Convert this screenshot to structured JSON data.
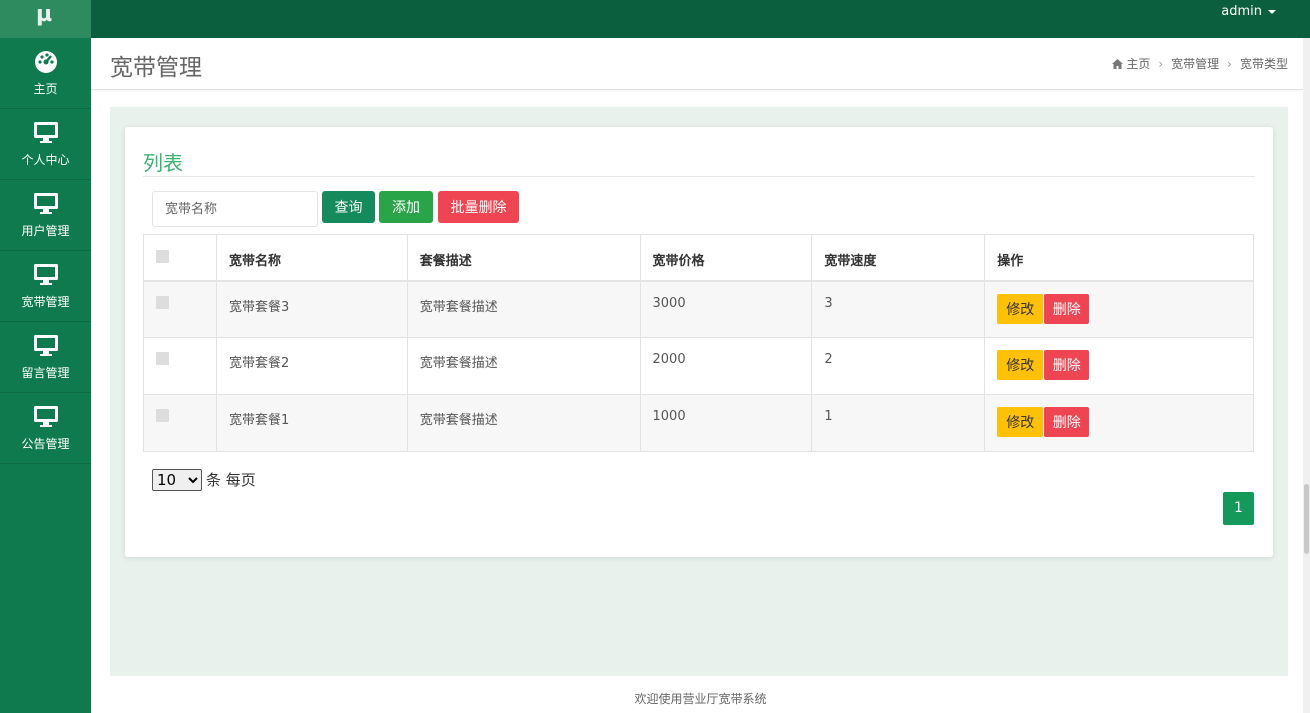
{
  "app": {
    "logo_text": "µ",
    "user_label": "admin"
  },
  "sidebar": {
    "items": [
      {
        "label": "主页",
        "icon": "dashboard-icon"
      },
      {
        "label": "个人中心",
        "icon": "monitor-icon"
      },
      {
        "label": "用户管理",
        "icon": "monitor-icon"
      },
      {
        "label": "宽带管理",
        "icon": "monitor-icon"
      },
      {
        "label": "留言管理",
        "icon": "monitor-icon"
      },
      {
        "label": "公告管理",
        "icon": "monitor-icon"
      }
    ]
  },
  "header": {
    "title": "宽带管理",
    "breadcrumb": [
      "主页",
      "宽带管理",
      "宽带类型"
    ]
  },
  "panel": {
    "title": "列表",
    "search_placeholder": "宽带名称",
    "query_label": "查询",
    "add_label": "添加",
    "batch_delete_label": "批量删除"
  },
  "table": {
    "columns": [
      "宽带名称",
      "套餐描述",
      "宽带价格",
      "宽带速度",
      "操作"
    ],
    "rows": [
      {
        "name": "宽带套餐3",
        "desc": "宽带套餐描述",
        "price": "3000",
        "speed": "3"
      },
      {
        "name": "宽带套餐2",
        "desc": "宽带套餐描述",
        "price": "2000",
        "speed": "2"
      },
      {
        "name": "宽带套餐1",
        "desc": "宽带套餐描述",
        "price": "1000",
        "speed": "1"
      }
    ],
    "edit_label": "修改",
    "delete_label": "删除"
  },
  "pagination": {
    "page_size": "10",
    "page_size_suffix": "条 每页",
    "current_page": "1"
  },
  "footer": {
    "text": "欢迎使用营业厅宽带系统"
  },
  "colors": {
    "topbar": "#0c5f3e",
    "sidebar": "#0f7a4d",
    "accent": "#39b36f",
    "danger": "#ef4553",
    "warning": "#ffc107"
  }
}
